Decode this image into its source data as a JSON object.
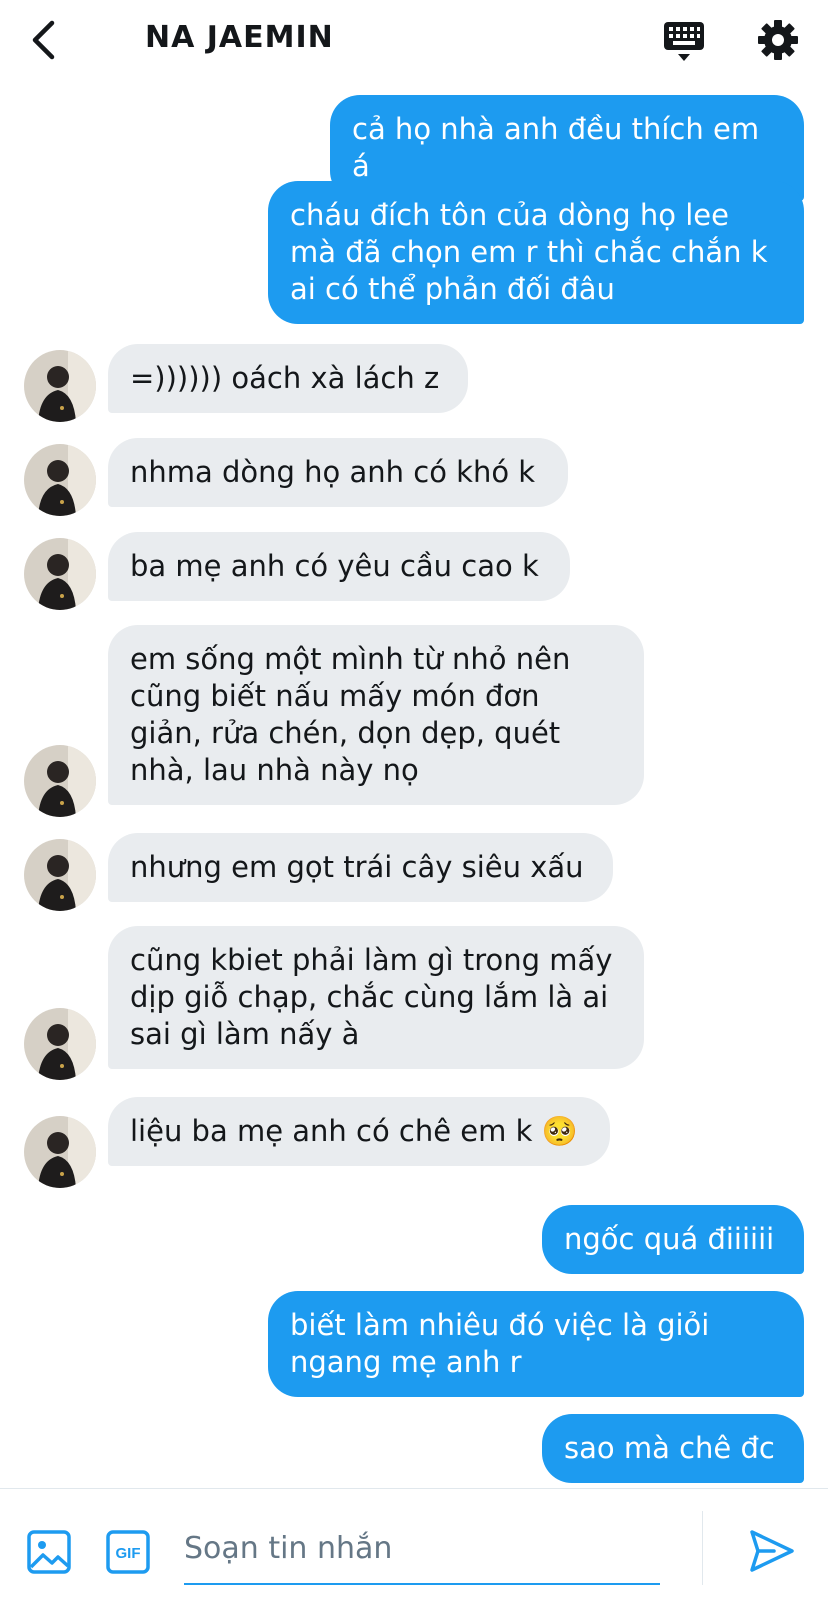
{
  "header": {
    "title": "NA JAEMIN",
    "back_icon": "chevron-left-icon",
    "keyboard_icon": "keyboard-icon",
    "settings_icon": "gear-icon"
  },
  "colors": {
    "accent": "#1d9bf0",
    "incoming_bubble": "#e9ecef",
    "text": "#14171a"
  },
  "messages": [
    {
      "direction": "out",
      "text": "cả họ nhà anh đều thích em á"
    },
    {
      "direction": "out",
      "text": "cháu đích tôn của dòng họ lee\nmà đã chọn em r thì chắc chắn k\nai có thể phản đối đâu"
    },
    {
      "direction": "in",
      "text": "=)))))) oách xà lách z"
    },
    {
      "direction": "in",
      "text": "nhma dòng họ anh có khó k"
    },
    {
      "direction": "in",
      "text": "ba mẹ anh có yêu cầu cao k"
    },
    {
      "direction": "in",
      "text": "em sống một mình từ nhỏ nên\ncũng biết nấu mấy món đơn\ngiản, rửa chén, dọn dẹp, quét\nnhà, lau nhà này nọ"
    },
    {
      "direction": "in",
      "text": "nhưng em gọt trái cây siêu xấu"
    },
    {
      "direction": "in",
      "text": "cũng kbiet phải làm gì trong mấy\ndịp giỗ chạp, chắc cùng lắm là ai\nsai gì làm nấy à"
    },
    {
      "direction": "in",
      "text": "liệu ba mẹ anh có chê em k 🥺"
    },
    {
      "direction": "out",
      "text": "ngốc quá điiiiii"
    },
    {
      "direction": "out",
      "text": "biết làm nhiêu đó việc là giỏi\nngang mẹ anh r"
    },
    {
      "direction": "out",
      "text": "sao mà chê đc"
    }
  ],
  "composer": {
    "placeholder": "Soạn tin nhắn",
    "value": "",
    "media_icon": "image-icon",
    "gif_icon": "gif-icon",
    "gif_label": "GIF",
    "send_icon": "send-icon"
  }
}
